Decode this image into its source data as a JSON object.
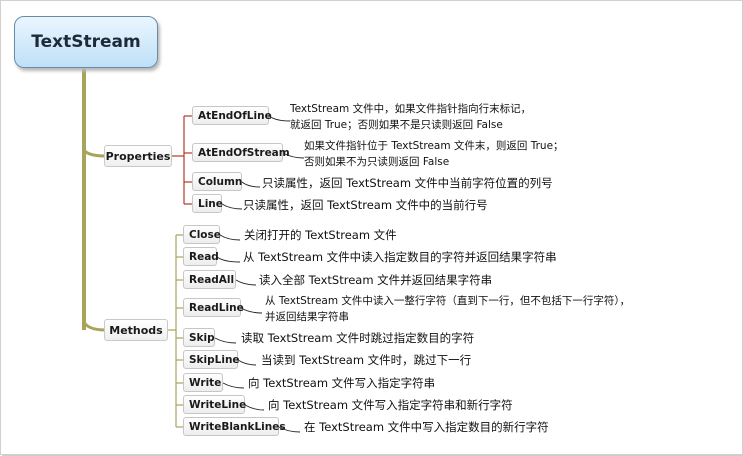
{
  "root": {
    "title": "TextStream"
  },
  "properties": {
    "label": "Properties",
    "items": [
      {
        "name": "AtEndOfLine",
        "desc": "TextStream 文件中，如果文件指针指向行末标记，\n就返回 True；否则如果不是只读则返回 False"
      },
      {
        "name": "AtEndOfStream",
        "desc": "如果文件指针位于 TextStream 文件末，则返回 True；\n否则如果不为只读则返回 False"
      },
      {
        "name": "Column",
        "desc": "只读属性，返回 TextStream 文件中当前字符位置的列号"
      },
      {
        "name": "Line",
        "desc": "只读属性，返回 TextStream 文件中的当前行号"
      }
    ]
  },
  "methods": {
    "label": "Methods",
    "items": [
      {
        "name": "Close",
        "desc": "关闭打开的 TextStream 文件"
      },
      {
        "name": "Read",
        "desc": "从 TextStream 文件中读入指定数目的字符并返回结果字符串"
      },
      {
        "name": "ReadAll",
        "desc": "读入全部 TextStream 文件并返回结果字符串"
      },
      {
        "name": "ReadLine",
        "desc": "从 TextStream 文件中读入一整行字符（直到下一行，但不包括下一行字符），\n并返回结果字符串"
      },
      {
        "name": "Skip",
        "desc": "读取 TextStream 文件时跳过指定数目的字符"
      },
      {
        "name": "SkipLine",
        "desc": "当读到 TextStream 文件时，跳过下一行"
      },
      {
        "name": "Write",
        "desc": "向 TextStream 文件写入指定字符串"
      },
      {
        "name": "WriteLine",
        "desc": "向 TextStream 文件写入指定字符串和新行字符"
      },
      {
        "name": "WriteBlankLines",
        "desc": "在 TextStream 文件中写入指定数目的新行字符"
      }
    ]
  },
  "colors": {
    "trunk": "#9e9a55",
    "prop_connector": "#b23a2a",
    "method_connector": "#9e9a55",
    "root_fill": "#cfe8fa"
  }
}
